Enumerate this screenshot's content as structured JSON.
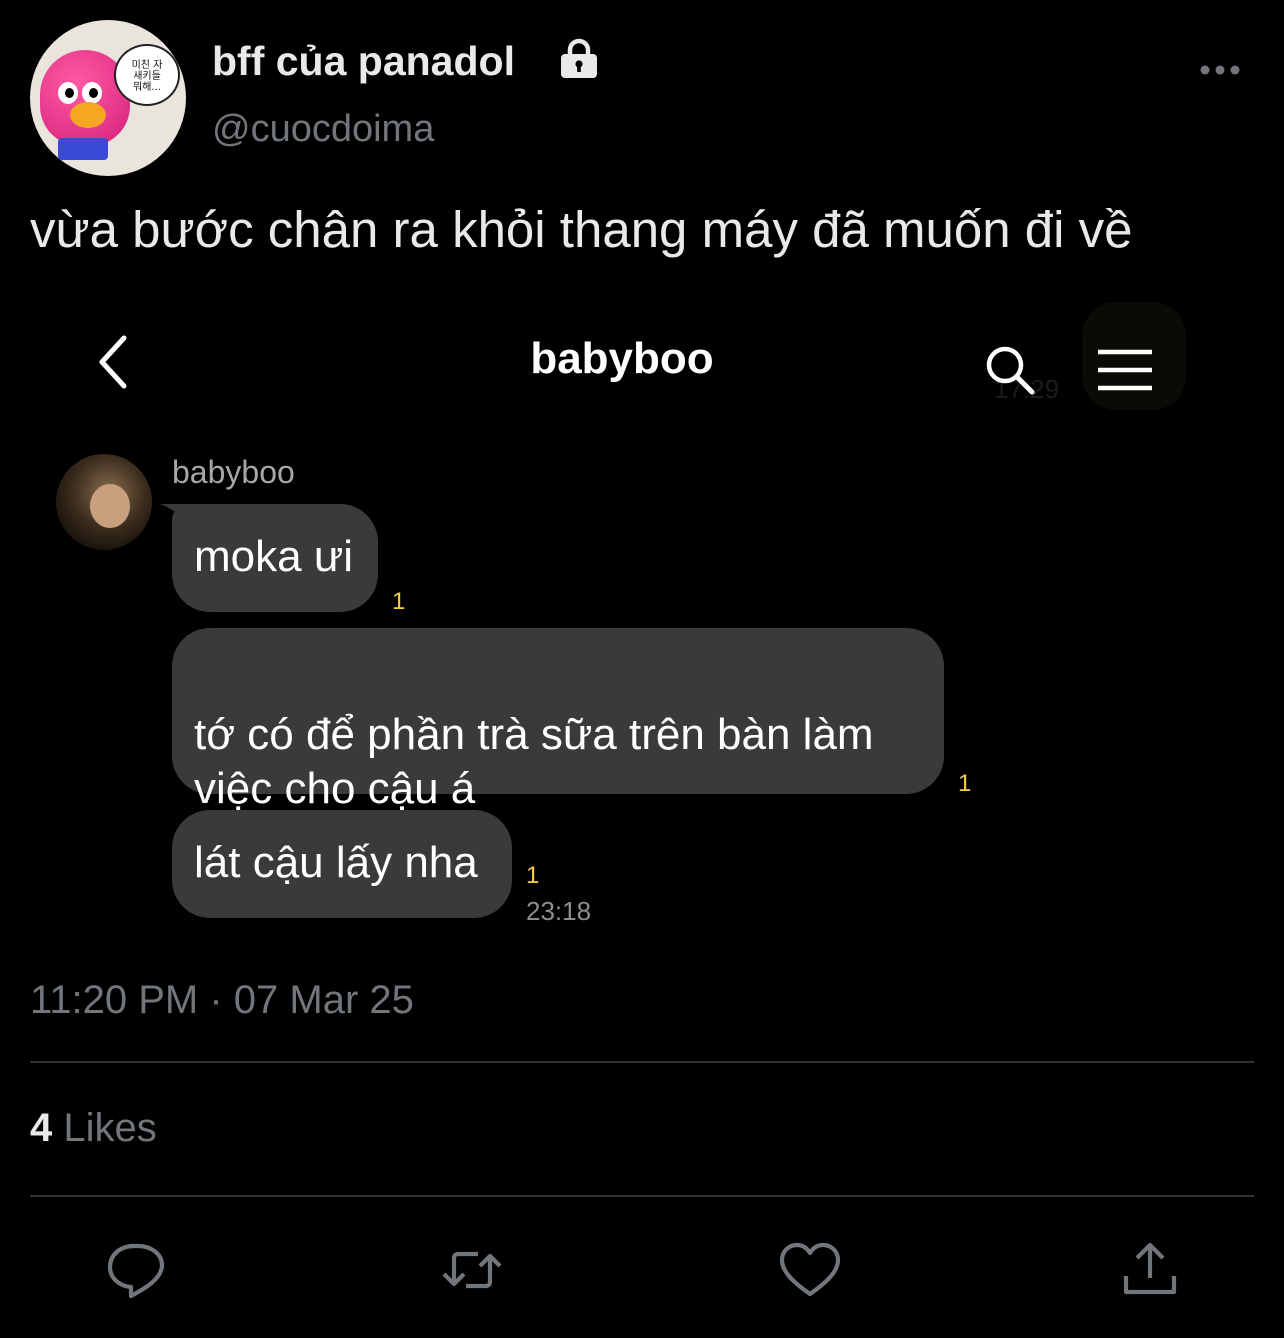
{
  "tweet": {
    "display_name": "bff của panadol",
    "handle": "@cuocdoima",
    "avatar_bubble_text": "미친 자\n새키들\n뭐해...",
    "text": "vừa bước chân ra khỏi thang máy đã muốn đi về",
    "timestamp": "11:20 PM · 07 Mar 25",
    "likes_count": "4",
    "likes_label": "Likes"
  },
  "chat": {
    "title": "babyboo",
    "sender_name": "babyboo",
    "ghost_time": "17:29",
    "messages": [
      {
        "text": "moka ưi",
        "unread": "1"
      },
      {
        "text": "tớ có để phần trà sữa trên bàn làm\nviệc cho cậu á",
        "unread": "1"
      },
      {
        "text": "lát cậu lấy nha",
        "unread": "1",
        "time": "23:18"
      }
    ]
  },
  "icons": {
    "lock": "lock-icon",
    "more": "more-icon",
    "back": "chevron-left-icon",
    "search": "search-icon",
    "menu": "hamburger-menu-icon",
    "reply": "reply-icon",
    "retweet": "retweet-icon",
    "like": "heart-icon",
    "share": "share-icon"
  },
  "colors": {
    "background": "#000000",
    "primary_text": "#e7e9ea",
    "secondary_text": "#71767b",
    "bubble": "#3a3a3c",
    "unread_badge": "#f4d03f"
  }
}
